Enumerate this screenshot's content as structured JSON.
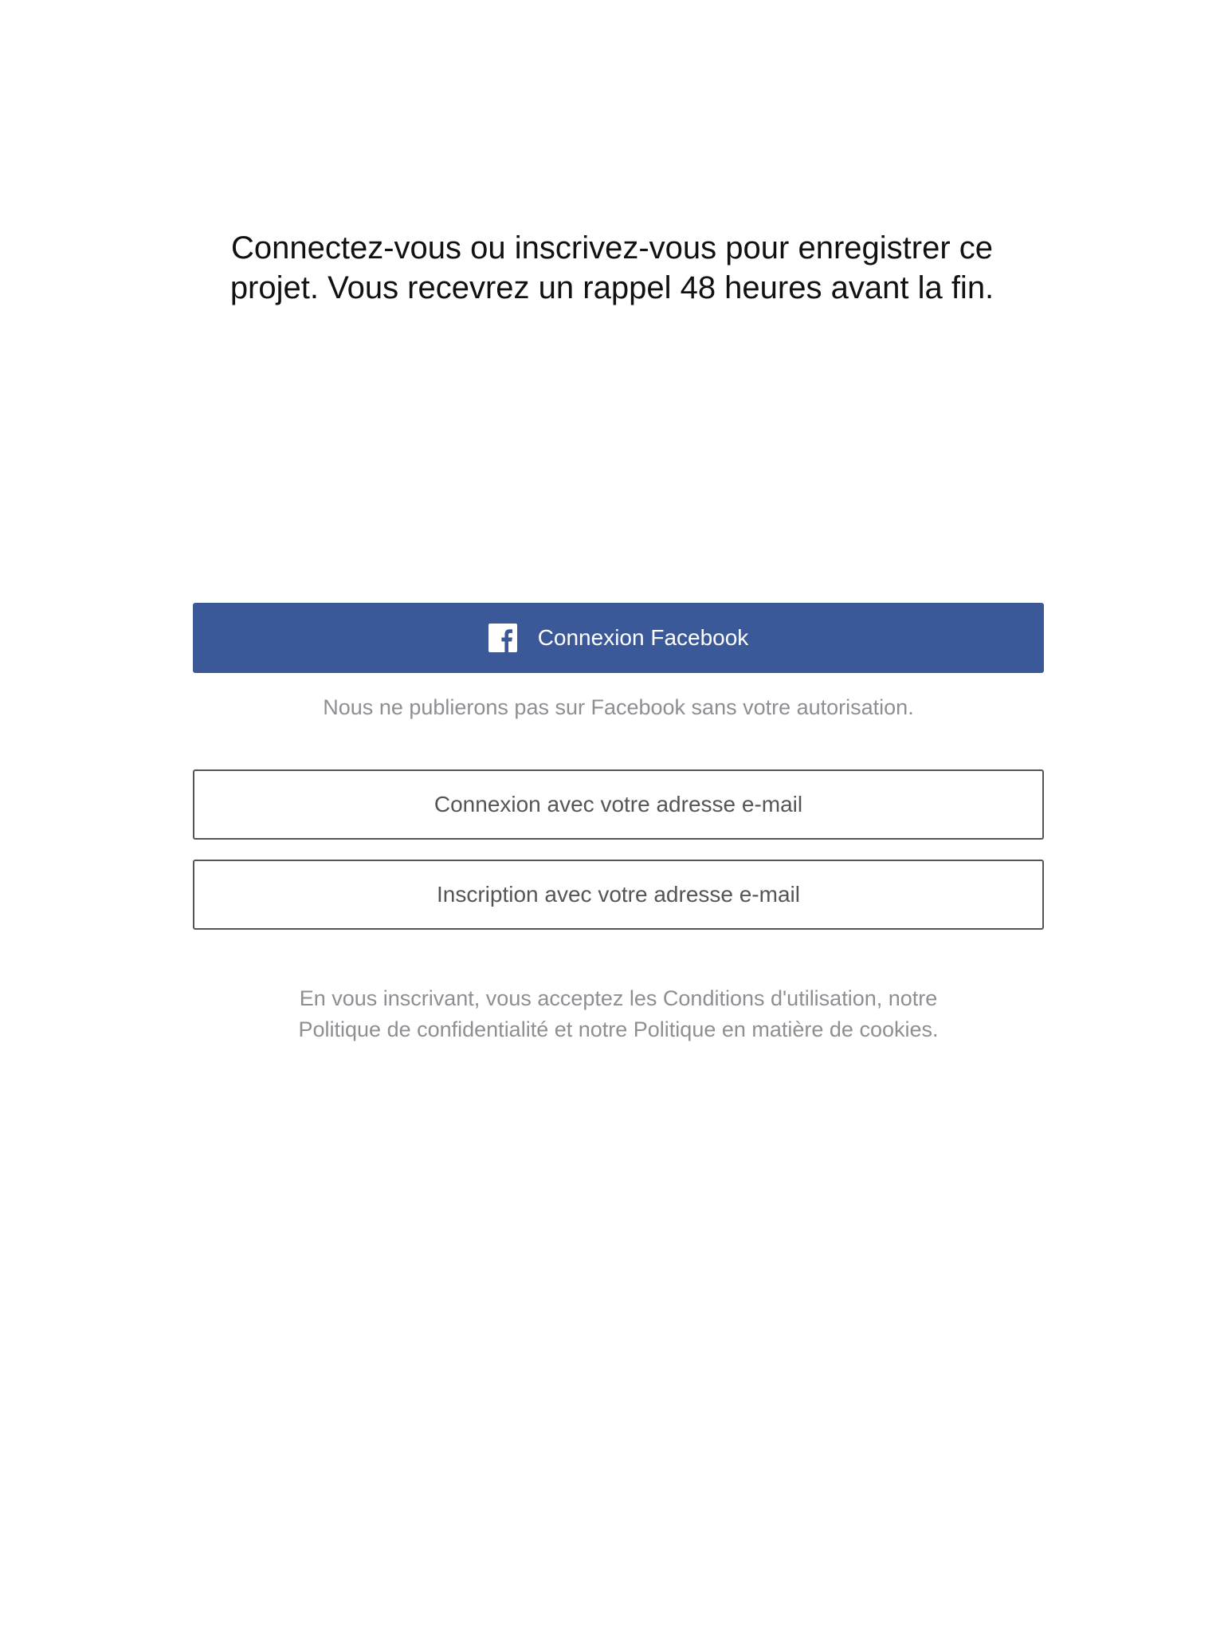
{
  "headline": {
    "line1": "Connectez-vous ou inscrivez-vous pour enregistrer ce",
    "line2": "projet. Vous recevrez un rappel 48 heures avant la fin."
  },
  "facebook": {
    "label": "Connexion Facebook",
    "icon": "facebook-icon",
    "note": "Nous ne publierons pas sur Facebook sans votre autorisation."
  },
  "email": {
    "login_label": "Connexion avec votre adresse e-mail",
    "signup_label": "Inscription avec votre adresse e-mail"
  },
  "terms": {
    "line1": "En vous inscrivant, vous acceptez les Conditions d'utilisation, notre",
    "line2": "Politique de confidentialité et notre Politique en matière de cookies."
  },
  "colors": {
    "facebook_blue": "#3b5998",
    "text_primary": "#111111",
    "text_muted": "#8e8e93",
    "outline": "#555555"
  }
}
